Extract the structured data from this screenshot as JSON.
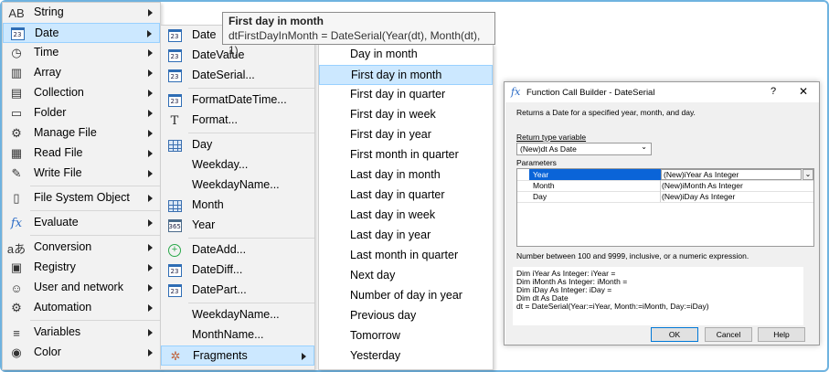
{
  "menu_main": {
    "items": [
      {
        "icon": "string-icon",
        "glyph": "AB",
        "label": "String",
        "arrow": true
      },
      {
        "icon": "date-icon",
        "glyph": "23",
        "label": "Date",
        "arrow": true,
        "highlight": true
      },
      {
        "icon": "time-icon",
        "glyph": "◷",
        "label": "Time",
        "arrow": true
      },
      {
        "icon": "array-icon",
        "glyph": "▥",
        "label": "Array",
        "arrow": true
      },
      {
        "icon": "collection-icon",
        "glyph": "▤",
        "label": "Collection",
        "arrow": true
      },
      {
        "icon": "folder-icon",
        "glyph": "▭",
        "label": "Folder",
        "arrow": true
      },
      {
        "icon": "manage-file-icon",
        "glyph": "⚙",
        "label": "Manage File",
        "arrow": true
      },
      {
        "icon": "read-file-icon",
        "glyph": "▦",
        "label": "Read File",
        "arrow": true
      },
      {
        "icon": "write-file-icon",
        "glyph": "✎",
        "label": "Write File",
        "arrow": true
      },
      {
        "sep": true
      },
      {
        "icon": "file-system-object-icon",
        "glyph": "▯",
        "label": "File System Object",
        "arrow": true
      },
      {
        "sep": true
      },
      {
        "icon": "evaluate-icon",
        "glyph": "fx",
        "label": "Evaluate",
        "arrow": true
      },
      {
        "sep": true
      },
      {
        "icon": "conversion-icon",
        "glyph": "aあ",
        "label": "Conversion",
        "arrow": true
      },
      {
        "icon": "registry-icon",
        "glyph": "▣",
        "label": "Registry",
        "arrow": true
      },
      {
        "icon": "user-network-icon",
        "glyph": "☺",
        "label": "User and network",
        "arrow": true
      },
      {
        "icon": "automation-icon",
        "glyph": "⚙",
        "label": "Automation",
        "arrow": true
      },
      {
        "sep": true
      },
      {
        "icon": "variables-icon",
        "glyph": "≡",
        "label": "Variables",
        "arrow": true
      },
      {
        "icon": "color-icon",
        "glyph": "◉",
        "label": "Color",
        "arrow": true
      }
    ]
  },
  "menu_date": {
    "items": [
      {
        "icon": "calendar-icon",
        "glyph": "23",
        "label": "Date",
        "arrow": true
      },
      {
        "icon": "calendar-icon",
        "glyph": "23",
        "label": "DateValue",
        "arrow": false
      },
      {
        "icon": "calendar-icon",
        "glyph": "23",
        "label": "DateSerial...",
        "arrow": false
      },
      {
        "sep": true
      },
      {
        "icon": "calendar-icon",
        "glyph": "23",
        "label": "FormatDateTime...",
        "arrow": false
      },
      {
        "icon": "format-icon",
        "glyph": "T",
        "label": "Format...",
        "arrow": false
      },
      {
        "sep": true
      },
      {
        "icon": "calendar-grid-icon",
        "glyph": "",
        "label": "Day",
        "arrow": false
      },
      {
        "icon": "",
        "glyph": "",
        "label": "Weekday...",
        "arrow": false
      },
      {
        "icon": "",
        "glyph": "",
        "label": "WeekdayName...",
        "arrow": false
      },
      {
        "icon": "calendar-month-icon",
        "glyph": "",
        "label": "Month",
        "arrow": false
      },
      {
        "icon": "calendar-year-icon",
        "glyph": "365",
        "label": "Year",
        "arrow": false
      },
      {
        "sep": true
      },
      {
        "icon": "date-add-icon",
        "glyph": "+",
        "label": "DateAdd...",
        "arrow": false
      },
      {
        "icon": "calendar-icon",
        "glyph": "23",
        "label": "DateDiff...",
        "arrow": false
      },
      {
        "icon": "calendar-icon",
        "glyph": "23",
        "label": "DatePart...",
        "arrow": false
      },
      {
        "sep": true
      },
      {
        "icon": "",
        "glyph": "",
        "label": "WeekdayName...",
        "arrow": false
      },
      {
        "icon": "",
        "glyph": "",
        "label": "MonthName...",
        "arrow": false
      },
      {
        "icon": "fragments-icon",
        "glyph": "✲",
        "label": "Fragments",
        "arrow": true,
        "highlight": true
      }
    ]
  },
  "menu_fragments": {
    "items": [
      {
        "label": "Day in month"
      },
      {
        "label": "First day in month",
        "highlight": true
      },
      {
        "label": "First day in quarter"
      },
      {
        "label": "First day in week"
      },
      {
        "label": "First day in year"
      },
      {
        "label": "First month in quarter"
      },
      {
        "label": "Last day in month"
      },
      {
        "label": "Last day in quarter"
      },
      {
        "label": "Last day in week"
      },
      {
        "label": "Last day in year"
      },
      {
        "label": "Last month in quarter"
      },
      {
        "label": "Next day"
      },
      {
        "label": "Number of day in year"
      },
      {
        "label": "Previous day"
      },
      {
        "label": "Tomorrow"
      },
      {
        "label": "Yesterday"
      }
    ]
  },
  "tooltip": {
    "title": "First day in month",
    "code": "dtFirstDayInMonth = DateSerial(Year(dt), Month(dt), 1)"
  },
  "dialog": {
    "title": "Function Call Builder - DateSerial",
    "fx_glyph": "fx",
    "help_glyph": "?",
    "close_glyph": "✕",
    "description": "Returns a  Date for a specified year, month, and day.",
    "return_type_label": "Return type variable",
    "return_type_value": "(New)dt As Date",
    "parameters_label": "Parameters",
    "parameters": [
      {
        "name": "Year",
        "value": "(New)iYear As Integer"
      },
      {
        "name": "Month",
        "value": "(New)iMonth As Integer"
      },
      {
        "name": "Day",
        "value": "(New)iDay As Integer"
      }
    ],
    "hint": "Number between 100 and 9999, inclusive, or a numeric expression.",
    "code_lines": [
      "Dim iYear As Integer: iYear =",
      "Dim iMonth As Integer: iMonth =",
      "Dim iDay As Integer: iDay =",
      "Dim dt As Date",
      "dt = DateSerial(Year:=iYear, Month:=iMonth, Day:=iDay)"
    ],
    "buttons": {
      "ok": "OK",
      "cancel": "Cancel",
      "help": "Help"
    }
  },
  "colors": {
    "highlight": "#cce8ff",
    "highlight_border": "#99d1ff",
    "selection": "#0a64d8",
    "frame": "#6fb3e0"
  }
}
